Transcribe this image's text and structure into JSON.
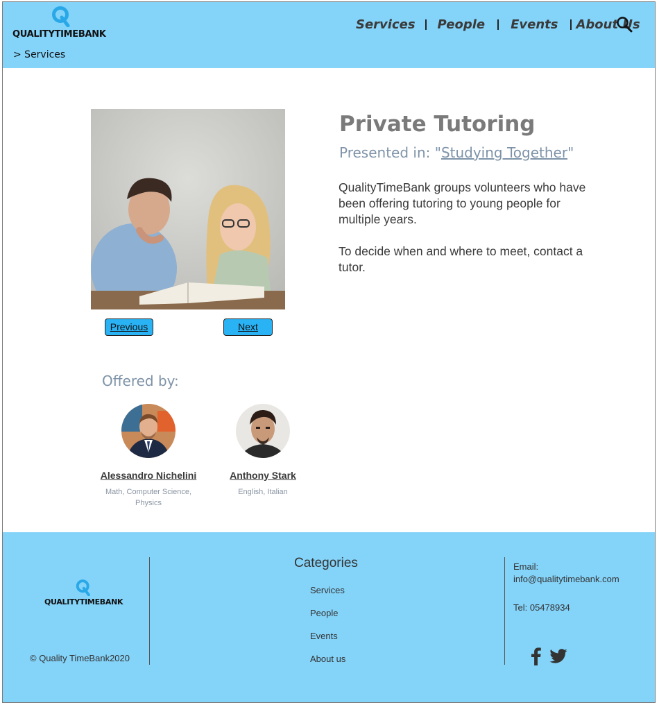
{
  "header": {
    "logo_text": "QUALITYTIMEBANK",
    "breadcrumb": "> Services",
    "nav": [
      "Services",
      "People",
      "Events",
      "About Us"
    ],
    "search_icon": "search-icon"
  },
  "service": {
    "title": "Private Tutoring",
    "presented_prefix": "Presented in: \"",
    "presented_link": "Studying Together",
    "presented_suffix": "\"",
    "description": [
      "QualityTimeBank groups volunteers who have been offering tutoring to young people for multiple years.",
      "To decide when and where to meet, contact a tutor."
    ],
    "prev_label": "Previous",
    "next_label": "Next"
  },
  "offered_by": {
    "heading": "Offered by:",
    "people": [
      {
        "name": "Alessandro Nichelini",
        "skills": "Math, Computer Science, Physics"
      },
      {
        "name": "Anthony Stark",
        "skills": "English, Italian"
      }
    ]
  },
  "footer": {
    "logo_text": "QUALITYTIMEBANK",
    "copyright": "© Quality TimeBank2020",
    "categories_title": "Categories",
    "categories": [
      "Services",
      "People",
      "Events",
      "About us"
    ],
    "email_label": "Email:",
    "email": "info@qualitytimebank.com",
    "tel": "Tel: 05478934",
    "social_icons": [
      "facebook-icon",
      "twitter-icon"
    ]
  },
  "colors": {
    "header_bg": "#84d3f9",
    "button_bg": "#29b2f4",
    "title": "#7a7a7a",
    "subtitle": "#7e93a8"
  }
}
